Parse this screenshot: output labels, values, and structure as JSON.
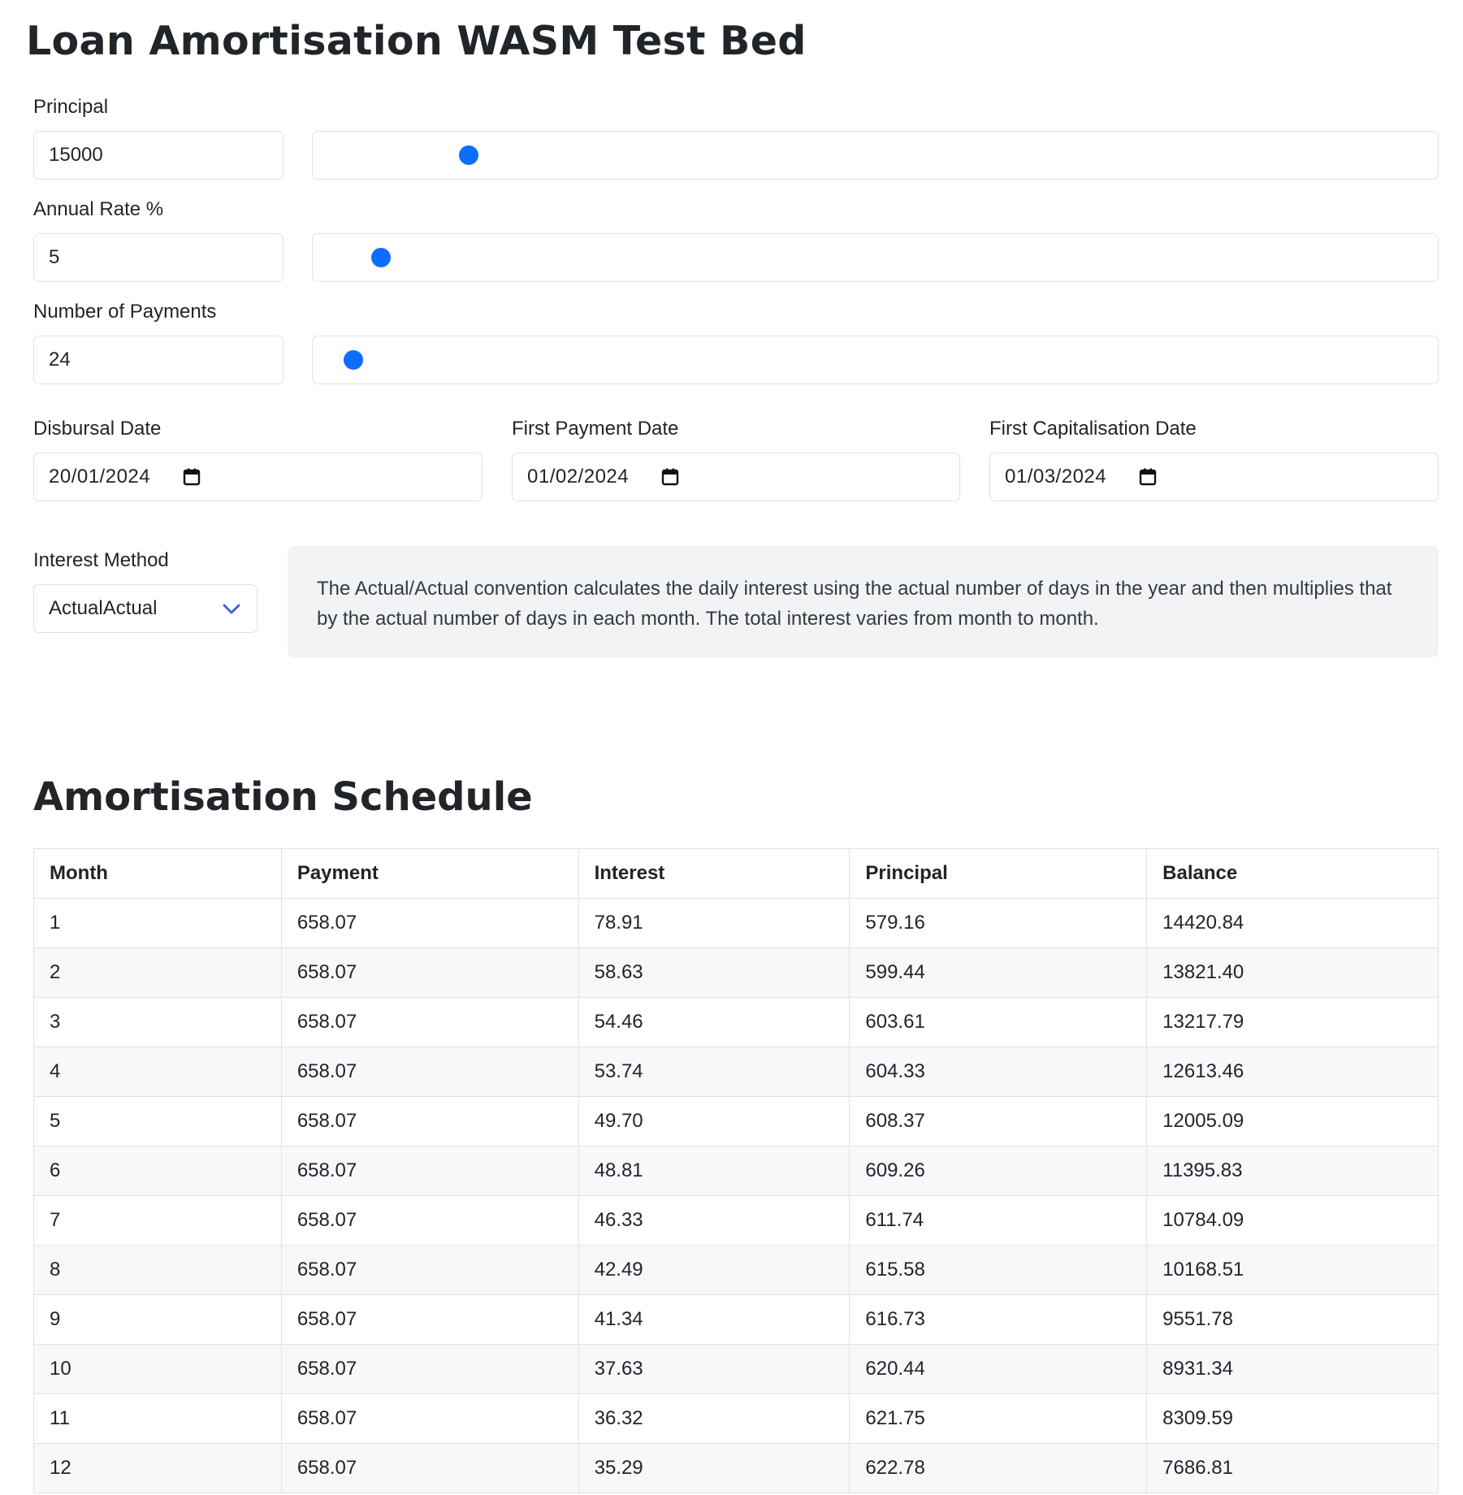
{
  "page": {
    "title": "Loan Amortisation WASM Test Bed"
  },
  "inputs": {
    "principal": {
      "label": "Principal",
      "value": "15000",
      "slider_fraction": 0.13
    },
    "annual_rate": {
      "label": "Annual Rate %",
      "value": "5",
      "slider_fraction": 0.05
    },
    "num_payments": {
      "label": "Number of Payments",
      "value": "24",
      "slider_fraction": 0.025
    }
  },
  "dates": {
    "disbursal": {
      "label": "Disbursal Date",
      "value": "20/01/2024"
    },
    "first_payment": {
      "label": "First Payment Date",
      "value": "01/02/2024"
    },
    "first_capitalisation": {
      "label": "First Capitalisation Date",
      "value": "01/03/2024"
    }
  },
  "interest_method": {
    "label": "Interest Method",
    "value": "ActualActual",
    "description": "The Actual/Actual convention calculates the daily interest using the actual number of days in the year and then multiplies that by the actual number of days in each month. The total interest varies from month to month."
  },
  "schedule": {
    "title": "Amortisation Schedule",
    "columns": [
      "Month",
      "Payment",
      "Interest",
      "Principal",
      "Balance"
    ],
    "rows": [
      [
        "1",
        "658.07",
        "78.91",
        "579.16",
        "14420.84"
      ],
      [
        "2",
        "658.07",
        "58.63",
        "599.44",
        "13821.40"
      ],
      [
        "3",
        "658.07",
        "54.46",
        "603.61",
        "13217.79"
      ],
      [
        "4",
        "658.07",
        "53.74",
        "604.33",
        "12613.46"
      ],
      [
        "5",
        "658.07",
        "49.70",
        "608.37",
        "12005.09"
      ],
      [
        "6",
        "658.07",
        "48.81",
        "609.26",
        "11395.83"
      ],
      [
        "7",
        "658.07",
        "46.33",
        "611.74",
        "10784.09"
      ],
      [
        "8",
        "658.07",
        "42.49",
        "615.58",
        "10168.51"
      ],
      [
        "9",
        "658.07",
        "41.34",
        "616.73",
        "9551.78"
      ],
      [
        "10",
        "658.07",
        "37.63",
        "620.44",
        "8931.34"
      ],
      [
        "11",
        "658.07",
        "36.32",
        "621.75",
        "8309.59"
      ],
      [
        "12",
        "658.07",
        "35.29",
        "622.78",
        "7686.81"
      ]
    ]
  },
  "colors": {
    "accent": "#0d6efd",
    "select_chevron": "#3b5bdb",
    "info_bg": "#f2f3f5"
  },
  "icons": {
    "date_picker": "calendar-icon",
    "select": "chevron-down-icon"
  }
}
